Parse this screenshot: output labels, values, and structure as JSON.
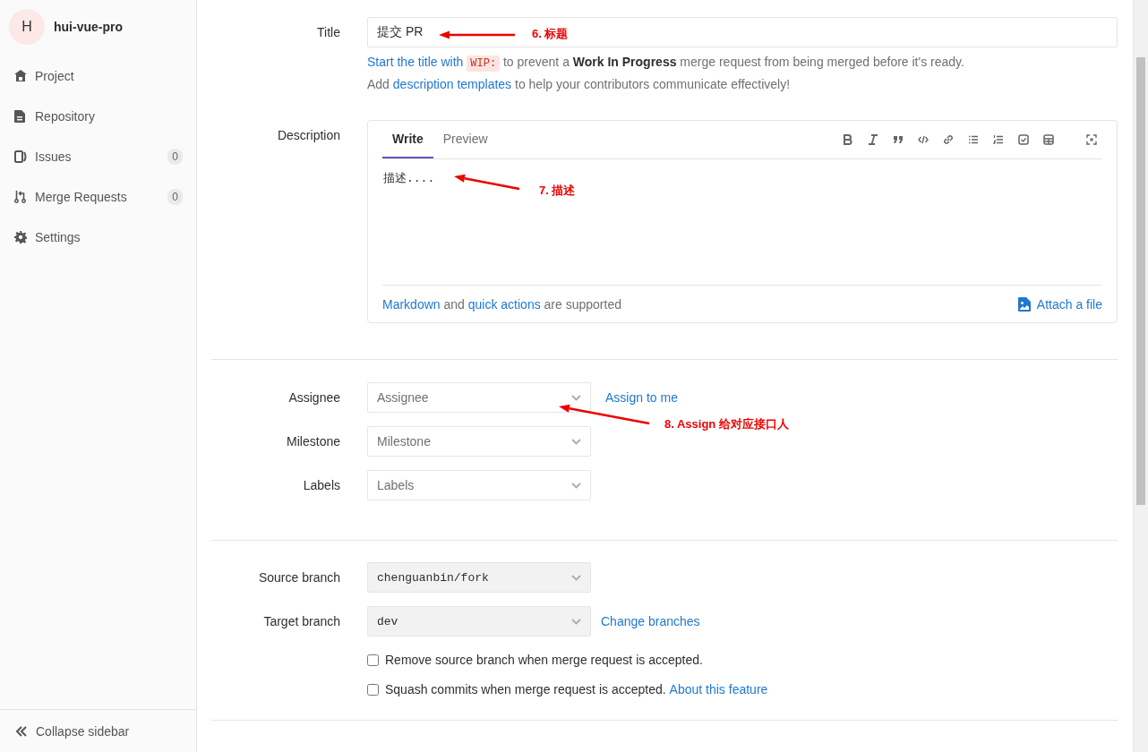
{
  "sidebar": {
    "avatar_letter": "H",
    "project_name": "hui-vue-pro",
    "items": [
      {
        "label": "Project",
        "selected": false
      },
      {
        "label": "Repository",
        "selected": false
      },
      {
        "label": "Issues",
        "count": "0",
        "selected": false
      },
      {
        "label": "Merge Requests",
        "count": "0",
        "selected": false
      },
      {
        "label": "Settings",
        "selected": false
      }
    ],
    "collapse_label": "Collapse sidebar"
  },
  "title_field": {
    "label": "Title",
    "value": "提交 PR",
    "hint_link": "Start the title with",
    "hint_code": "WIP:",
    "hint_text": "to prevent a **Work In Progress** merge request from being merged before it's ready.",
    "templates_before": "Add",
    "templates_link": "description templates",
    "templates_after": "to help your contributors communicate effectively!"
  },
  "description": {
    "label": "Description",
    "tabs": [
      {
        "label": "Write",
        "selected": true
      },
      {
        "label": "Preview",
        "selected": false
      }
    ],
    "value": "描述....",
    "footer": [
      {
        "kind": "link",
        "text": "Markdown"
      },
      {
        "kind": "text",
        "text": "and"
      },
      {
        "kind": "link",
        "text": "quick actions"
      },
      {
        "kind": "text",
        "text": "are supported"
      }
    ],
    "attach": "Attach a file"
  },
  "meta_fields": [
    {
      "label": "Assignee",
      "toggle_text": "Assignee",
      "disabled": false,
      "side_link": "Assign to me"
    },
    {
      "label": "Milestone",
      "toggle_text": "Milestone",
      "disabled": false
    },
    {
      "label": "Labels",
      "toggle_text": "Labels",
      "disabled": false
    }
  ],
  "branches": [
    {
      "label": "Source branch",
      "toggle_text": "chenguanbin/fork",
      "disabled": true
    },
    {
      "label": "Target branch",
      "toggle_text": "dev",
      "disabled": true,
      "side_link": "Change branches"
    }
  ],
  "options": [
    {
      "label": "Remove source branch when merge request is accepted.",
      "checked": false
    },
    {
      "label": "Squash commits when merge request is accepted.",
      "checked": false,
      "link": "About this feature"
    }
  ],
  "annotations": [
    {
      "text": "6. 标题"
    },
    {
      "text": "7. 描述"
    },
    {
      "text": "8. Assign 给对应接口人"
    }
  ]
}
